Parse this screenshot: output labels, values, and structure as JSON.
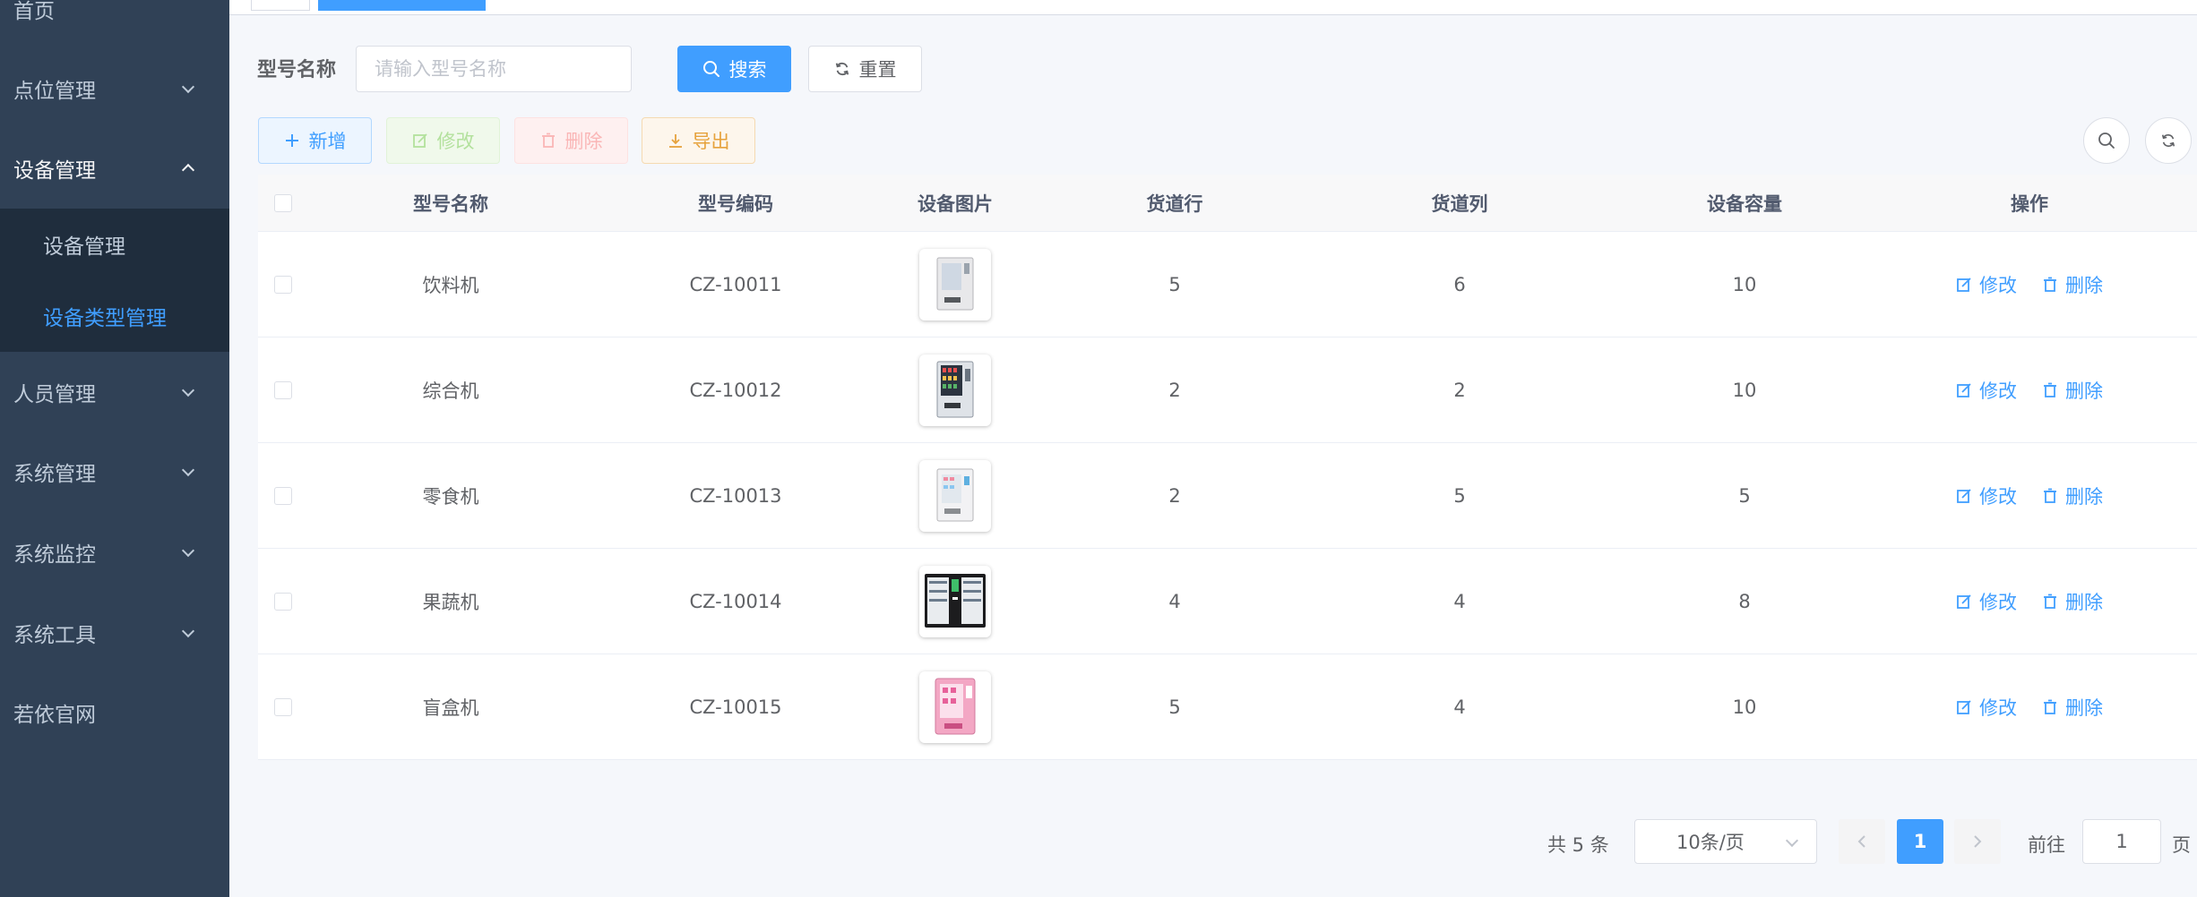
{
  "sidebar": {
    "items": [
      {
        "label": "首页"
      },
      {
        "label": "点位管理"
      },
      {
        "label": "设备管理"
      },
      {
        "label": "人员管理"
      },
      {
        "label": "系统管理"
      },
      {
        "label": "系统监控"
      },
      {
        "label": "系统工具"
      },
      {
        "label": "若依官网"
      }
    ],
    "submenu": [
      {
        "label": "设备管理"
      },
      {
        "label": "设备类型管理"
      }
    ]
  },
  "search": {
    "label": "型号名称",
    "placeholder": "请输入型号名称",
    "value": "",
    "search_label": "搜索",
    "reset_label": "重置"
  },
  "toolbar": {
    "add_label": "新增",
    "edit_label": "修改",
    "delete_label": "删除",
    "export_label": "导出"
  },
  "table": {
    "headers": [
      "型号名称",
      "型号编码",
      "设备图片",
      "货道行",
      "货道列",
      "设备容量",
      "操作"
    ],
    "rows": [
      {
        "name": "饮料机",
        "code": "CZ-10011",
        "rows": "5",
        "cols": "6",
        "capacity": "10",
        "edit": "修改",
        "delete": "删除"
      },
      {
        "name": "综合机",
        "code": "CZ-10012",
        "rows": "2",
        "cols": "2",
        "capacity": "10",
        "edit": "修改",
        "delete": "删除"
      },
      {
        "name": "零食机",
        "code": "CZ-10013",
        "rows": "2",
        "cols": "5",
        "capacity": "5",
        "edit": "修改",
        "delete": "删除"
      },
      {
        "name": "果蔬机",
        "code": "CZ-10014",
        "rows": "4",
        "cols": "4",
        "capacity": "8",
        "edit": "修改",
        "delete": "删除"
      },
      {
        "name": "盲盒机",
        "code": "CZ-10015",
        "rows": "5",
        "cols": "4",
        "capacity": "10",
        "edit": "修改",
        "delete": "删除"
      }
    ]
  },
  "pagination": {
    "total": "共 5 条",
    "page_size": "10条/页",
    "current": "1",
    "goto_label": "前往",
    "goto_value": "1",
    "page_suffix": "页"
  },
  "colors": {
    "primary": "#409eff",
    "sidebar_bg": "#304156",
    "submenu_bg": "#1f2d3d"
  }
}
